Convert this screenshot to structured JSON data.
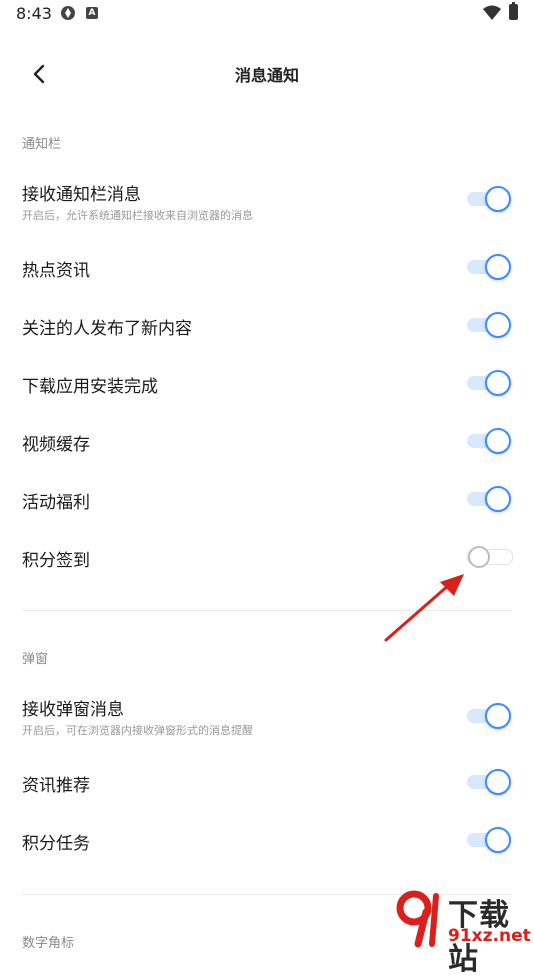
{
  "status_bar": {
    "time": "8:43",
    "app_icon": "A"
  },
  "header": {
    "title": "消息通知"
  },
  "sections": {
    "notification_bar": {
      "label": "通知栏",
      "items": [
        {
          "title": "接收通知栏消息",
          "desc": "开启后，允许系统通知栏接收来自浏览器的消息",
          "enabled": true
        },
        {
          "title": "热点资讯",
          "enabled": true
        },
        {
          "title": "关注的人发布了新内容",
          "enabled": true
        },
        {
          "title": "下载应用安装完成",
          "enabled": true
        },
        {
          "title": "视频缓存",
          "enabled": true
        },
        {
          "title": "活动福利",
          "enabled": true
        },
        {
          "title": "积分签到",
          "enabled": false
        }
      ]
    },
    "popup": {
      "label": "弹窗",
      "items": [
        {
          "title": "接收弹窗消息",
          "desc": "开启后，可在浏览器内接收弹窗形式的消息提醒",
          "enabled": true
        },
        {
          "title": "资讯推荐",
          "enabled": true
        },
        {
          "title": "积分任务",
          "enabled": true
        }
      ]
    },
    "badge": {
      "label": "数字角标"
    }
  },
  "watermark": {
    "brand": "下载站",
    "url": "91xz.net"
  },
  "colors": {
    "accent": "#3d8bff",
    "track_on": "#d7e8ff",
    "arrow": "#d9201a"
  },
  "icons": {
    "back": "chevron-left-icon",
    "wifi": "wifi-icon",
    "battery": "battery-icon"
  }
}
